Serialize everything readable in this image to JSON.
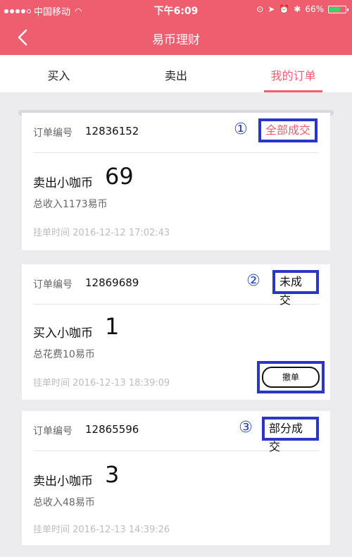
{
  "status_bar": {
    "carrier": "中国移动",
    "time": "下午6:09",
    "battery": "66%"
  },
  "nav": {
    "title": "易币理财"
  },
  "tabs": [
    {
      "label": "买入"
    },
    {
      "label": "卖出"
    },
    {
      "label": "我的订单"
    }
  ],
  "orders": [
    {
      "id_label": "订单编号",
      "id": "12836152",
      "marker": "①",
      "status": "全部成交",
      "trade_label": "卖出小咖币",
      "amount": "69",
      "summary": "总收入1173易币",
      "time": "挂单时间  2016-12-12 17:02:43"
    },
    {
      "id_label": "订单编号",
      "id": "12869689",
      "marker": "②",
      "status": "未成交",
      "trade_label": "买入小咖币",
      "amount": "1",
      "summary": "总花费10易币",
      "time": "挂单时间  2016-12-13 18:39:09",
      "action": "撤单"
    },
    {
      "id_label": "订单编号",
      "id": "12865596",
      "marker": "③",
      "status": "部分成交",
      "trade_label": "卖出小咖币",
      "amount": "3",
      "summary": "总收入48易币",
      "time": "挂单时间  2016-12-13 14:39:26"
    }
  ],
  "colors": {
    "brand": "#ef5e6f",
    "annotation": "#2a36c8"
  }
}
